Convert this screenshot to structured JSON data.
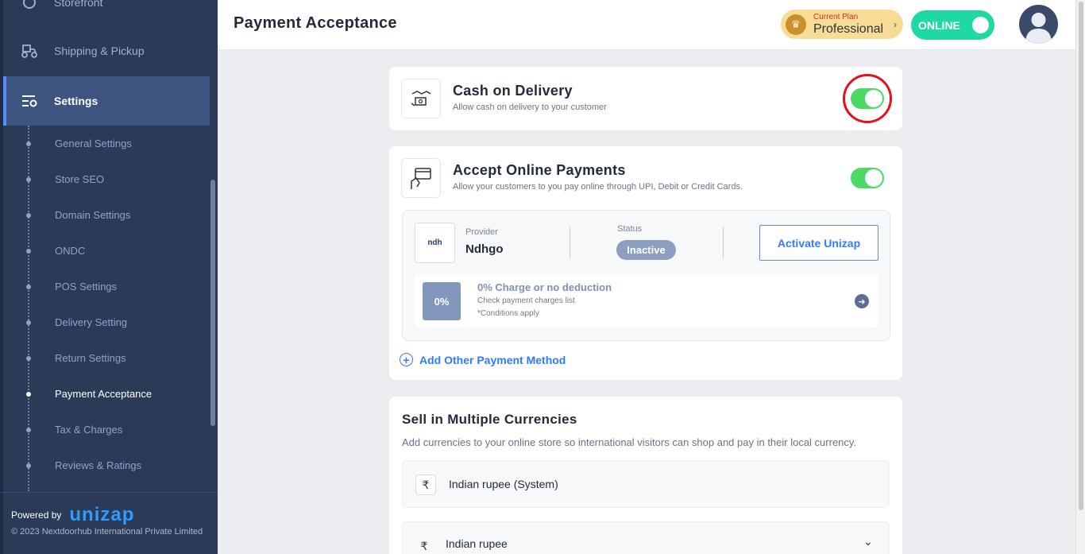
{
  "sidebar": {
    "top_items": [
      {
        "label": "Storefront"
      },
      {
        "label": "Shipping & Pickup"
      },
      {
        "label": "Settings"
      }
    ],
    "sub_items": [
      {
        "label": "General Settings"
      },
      {
        "label": "Store SEO"
      },
      {
        "label": "Domain Settings"
      },
      {
        "label": "ONDC"
      },
      {
        "label": "POS Settings"
      },
      {
        "label": "Delivery Setting"
      },
      {
        "label": "Return Settings"
      },
      {
        "label": "Payment Acceptance"
      },
      {
        "label": "Tax & Charges"
      },
      {
        "label": "Reviews & Ratings"
      }
    ],
    "current_sub": "Payment Acceptance",
    "footer": {
      "powered_by": "Powered by",
      "brand": "unizap",
      "copyright": "© 2023 Nextdoorhub International Private Limited"
    }
  },
  "header": {
    "title": "Payment Acceptance",
    "plan_caption": "Current Plan",
    "plan_name": "Professional",
    "status_label": "ONLINE"
  },
  "cod": {
    "title": "Cash on Delivery",
    "subtitle": "Allow cash on delivery to your customer",
    "enabled": true
  },
  "online_payments": {
    "title": "Accept Online Payments",
    "subtitle": "Allow your customers to you pay online through UPI, Debit or Credit Cards.",
    "enabled": true,
    "provider_label": "Provider",
    "provider_name": "Ndhgo",
    "provider_logo": "ndh",
    "status_label": "Status",
    "status_value": "Inactive",
    "activate_label": "Activate Unizap",
    "charge_badge": "0%",
    "charge_title": "0% Charge or no deduction",
    "charge_sub1": "Check payment charges list",
    "charge_sub2": "*Conditions apply",
    "add_method_label": "Add Other Payment Method"
  },
  "currencies": {
    "title": "Sell in Multiple Currencies",
    "subtitle": "Add currencies to your online store so international visitors can shop and pay in their local currency.",
    "rows": [
      {
        "symbol": "₹",
        "name": "Indian rupee (System)"
      },
      {
        "symbol": "₹",
        "name": "Indian rupee"
      }
    ]
  },
  "colors": {
    "sidebar_bg": "#2b3a57",
    "accent": "#2f7bff",
    "toggle_on": "#4cd964",
    "online": "#1fd9a5",
    "highlight": "#e4101c"
  }
}
